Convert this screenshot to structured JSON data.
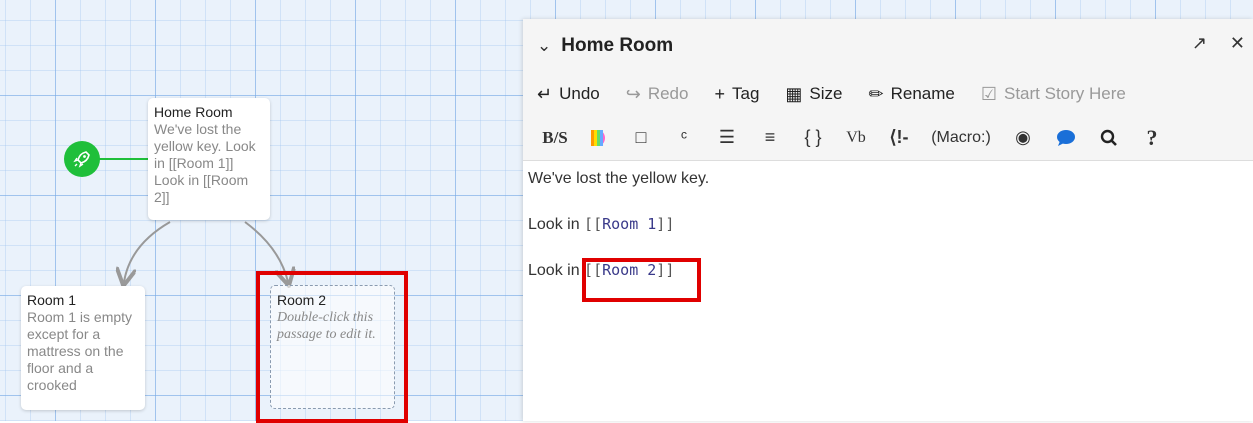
{
  "map": {
    "passages": [
      {
        "title": "Home Room",
        "excerpt": "We've lost the yellow key. Look in [[Room 1]] Look in [[Room 2]]"
      },
      {
        "title": "Room 1",
        "excerpt": "Room 1 is empty except for a mattress on the floor and a crooked"
      },
      {
        "title": "Room 2",
        "excerpt": "Double-click this passage to edit it."
      }
    ],
    "start_icon": "rocket-icon"
  },
  "dialog": {
    "title": "Home Room",
    "toolbar": {
      "undo": "Undo",
      "redo": "Redo",
      "tag": "Tag",
      "size": "Size",
      "rename": "Rename",
      "start_story": "Start Story Here"
    },
    "harlowe_toolbar": {
      "bold_strike": "B/S",
      "vb": "Vb",
      "comment": "⟨!-",
      "macro": "(Macro:)",
      "help": "?"
    },
    "text": {
      "line1": "We've lost the yellow key.",
      "line2_prefix": "Look in",
      "line2_link": "Room 1",
      "line3_prefix": "Look in",
      "line3_link": "Room 2"
    }
  },
  "colors": {
    "start_green": "#1fbf3a",
    "highlight_red": "#e00000",
    "link_blue": "#3a3a8a"
  }
}
